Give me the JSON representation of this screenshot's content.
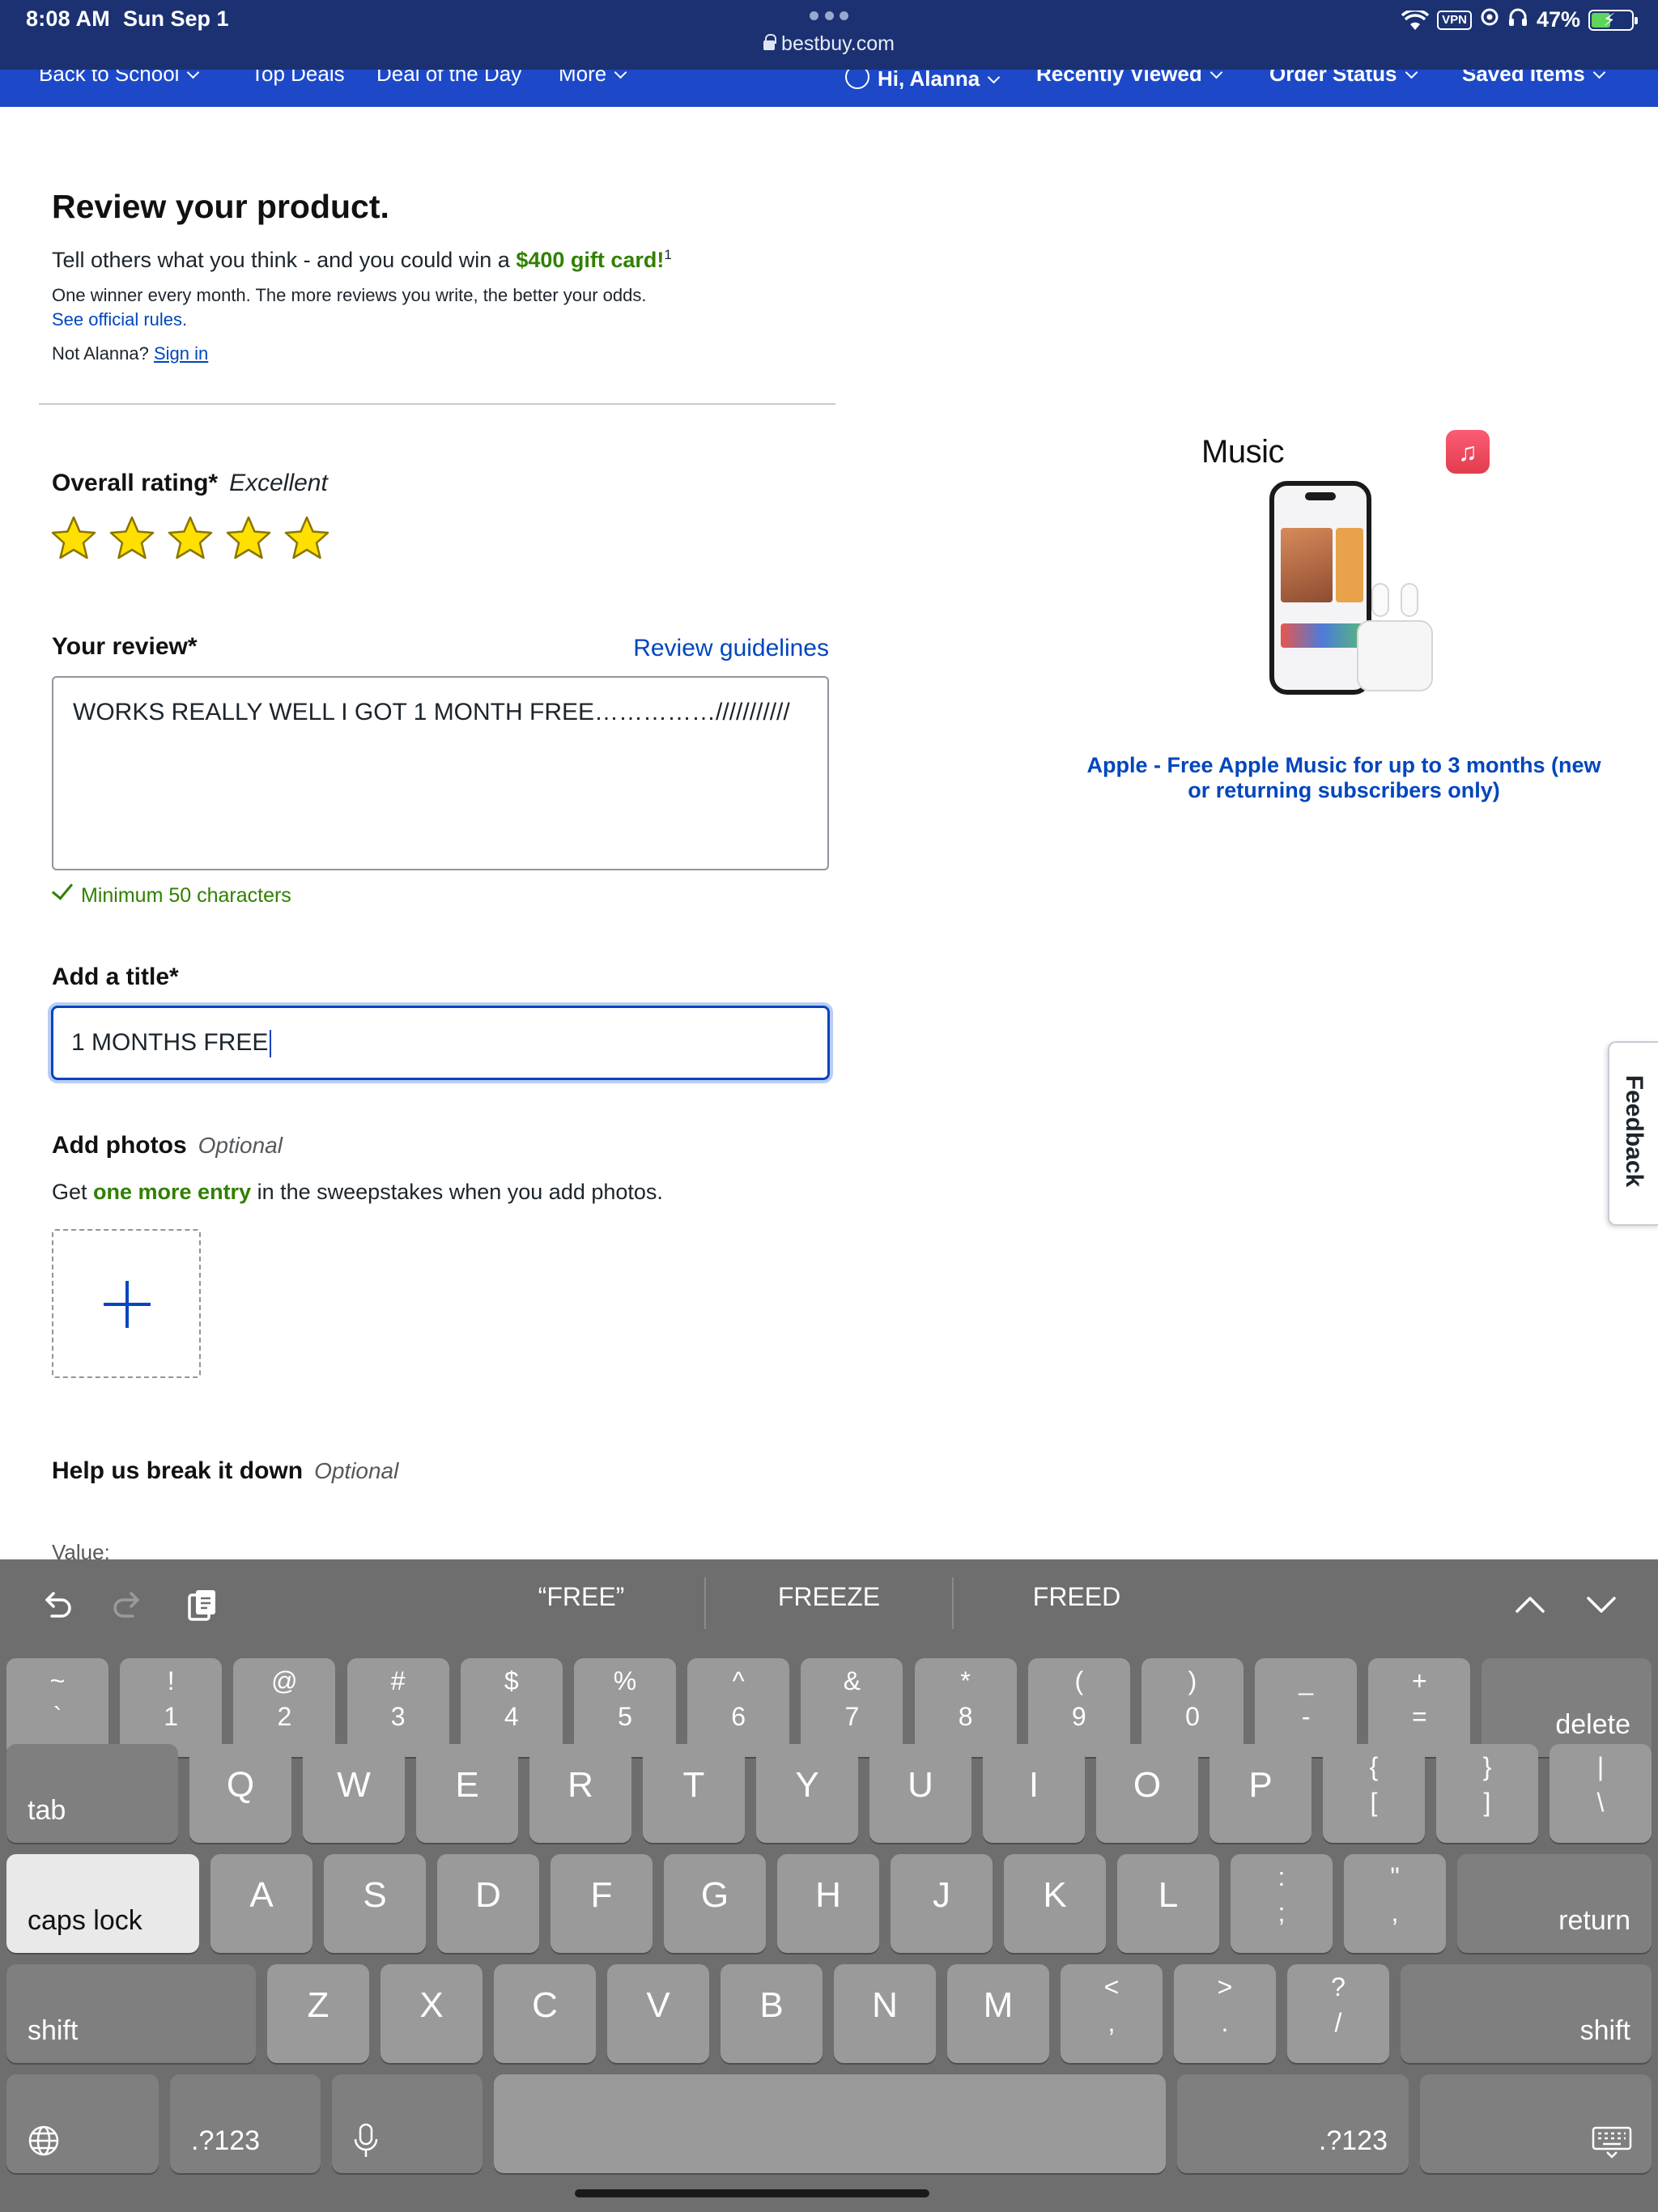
{
  "status_bar": {
    "time": "8:08 AM",
    "date": "Sun Sep 1",
    "url": "bestbuy.com",
    "vpn": "VPN",
    "battery": "47%",
    "battery_level": 0.47,
    "icons": [
      "wifi-icon",
      "vpn-badge",
      "focus-icon",
      "headphones-icon",
      "battery-icon"
    ]
  },
  "nav": {
    "items": [
      "Back to School",
      "Top Deals",
      "Deal of the Day",
      "More"
    ],
    "account": "Hi, Alanna",
    "recently_viewed": "Recently Viewed",
    "order_status": "Order Status",
    "saved_items": "Saved Items"
  },
  "review": {
    "heading": "Review your product.",
    "intro_prefix": "Tell others what you think - and you could win a ",
    "intro_highlight": "$400 gift card!",
    "intro_sup": "1",
    "winner_note": "One winner every month. The more reviews you write, the better your odds.",
    "official_rules": "See official rules.",
    "not_user": "Not Alanna?",
    "sign_in": "Sign in",
    "overall_rating_label": "Overall rating*",
    "rating_text": "Excellent",
    "rating_value": 5,
    "rating_max": 5,
    "your_review_label": "Your review*",
    "review_guidelines": "Review guidelines",
    "review_text": "WORKS REALLY WELL I GOT 1 MONTH FREE……………///////////",
    "min_chars": "Minimum 50 characters",
    "title_label": "Add a title*",
    "title_value": "1 MONTHS FREE",
    "photos_label": "Add photos",
    "optional": "Optional",
    "photos_desc_prefix": "Get ",
    "photos_desc_highlight": "one more entry",
    "photos_desc_suffix": " in the sweepstakes when you add photos.",
    "breakdown_label": "Help us break it down",
    "value_label": "Value:"
  },
  "promo": {
    "logo_text": "Music",
    "title": "Apple - Free Apple Music for up to 3 months (new or returning subscribers only)"
  },
  "feedback": "Feedback",
  "keyboard": {
    "suggestions": [
      "“FREE”",
      "FREEZE",
      "FREED"
    ],
    "number_row": [
      [
        "~",
        "`"
      ],
      [
        "!",
        "1"
      ],
      [
        "@",
        "2"
      ],
      [
        "#",
        "3"
      ],
      [
        "$",
        "4"
      ],
      [
        "%",
        "5"
      ],
      [
        "^",
        "6"
      ],
      [
        "&",
        "7"
      ],
      [
        "*",
        "8"
      ],
      [
        "(",
        "9"
      ],
      [
        ")",
        "0"
      ],
      [
        "_",
        "-"
      ],
      [
        "+",
        "="
      ]
    ],
    "row_q": [
      "Q",
      "W",
      "E",
      "R",
      "T",
      "Y",
      "U",
      "I",
      "O",
      "P"
    ],
    "row_q_symbols": [
      [
        "{",
        "["
      ],
      [
        "}",
        "]"
      ],
      [
        "|",
        "\\"
      ]
    ],
    "row_a": [
      "A",
      "S",
      "D",
      "F",
      "G",
      "H",
      "J",
      "K",
      "L"
    ],
    "row_a_symbols": [
      [
        ":",
        ";"
      ],
      [
        "\"",
        ","
      ]
    ],
    "row_z": [
      "Z",
      "X",
      "C",
      "V",
      "B",
      "N",
      "M"
    ],
    "row_z_symbols": [
      [
        "<",
        ","
      ],
      [
        ">",
        "."
      ],
      [
        "?",
        "/"
      ]
    ],
    "delete": "delete",
    "tab": "tab",
    "caps_lock": "caps lock",
    "return": "return",
    "shift": "shift",
    "num_switch": ".?123"
  },
  "colors": {
    "nav_blue": "#1d49c8",
    "status_bar": "#1b3172",
    "link_blue": "#0046be",
    "success_green": "#318000",
    "star_yellow": "#ffe000"
  }
}
